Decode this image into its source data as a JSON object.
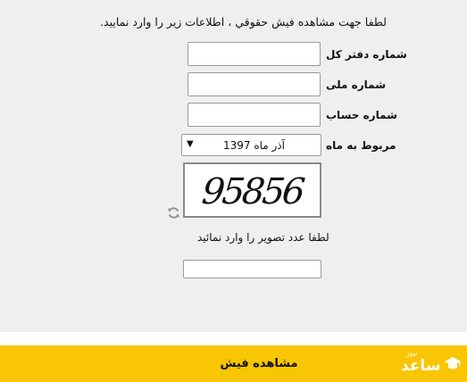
{
  "form": {
    "intro": "لطفا جهت مشاهده فیش حقوقي ، اطلاعات زیر را وارد نمایید.",
    "fields": {
      "general_ledger_label": "شماره دفتر کل",
      "national_id_label": "شماره ملی",
      "account_label": "شماره حساب",
      "month_label": "مربوط به ماه"
    },
    "month_select": {
      "value": "آذر ماه 1397"
    },
    "captcha": {
      "digits": "95856",
      "hint": "لطفا عدد تصویر را وارد نمائید"
    }
  },
  "footer": {
    "submit_label": "مشاهده فیش",
    "watermark_logo": "ساعد نیوز"
  },
  "colors": {
    "panel_bg": "#efefef",
    "footer_bg": "#f8c602",
    "input_border": "#9a9a9a"
  },
  "icons": {
    "refresh": "refresh-icon",
    "dropdown": "triangle-down-icon",
    "watermark": "graduation-cap-icon"
  }
}
